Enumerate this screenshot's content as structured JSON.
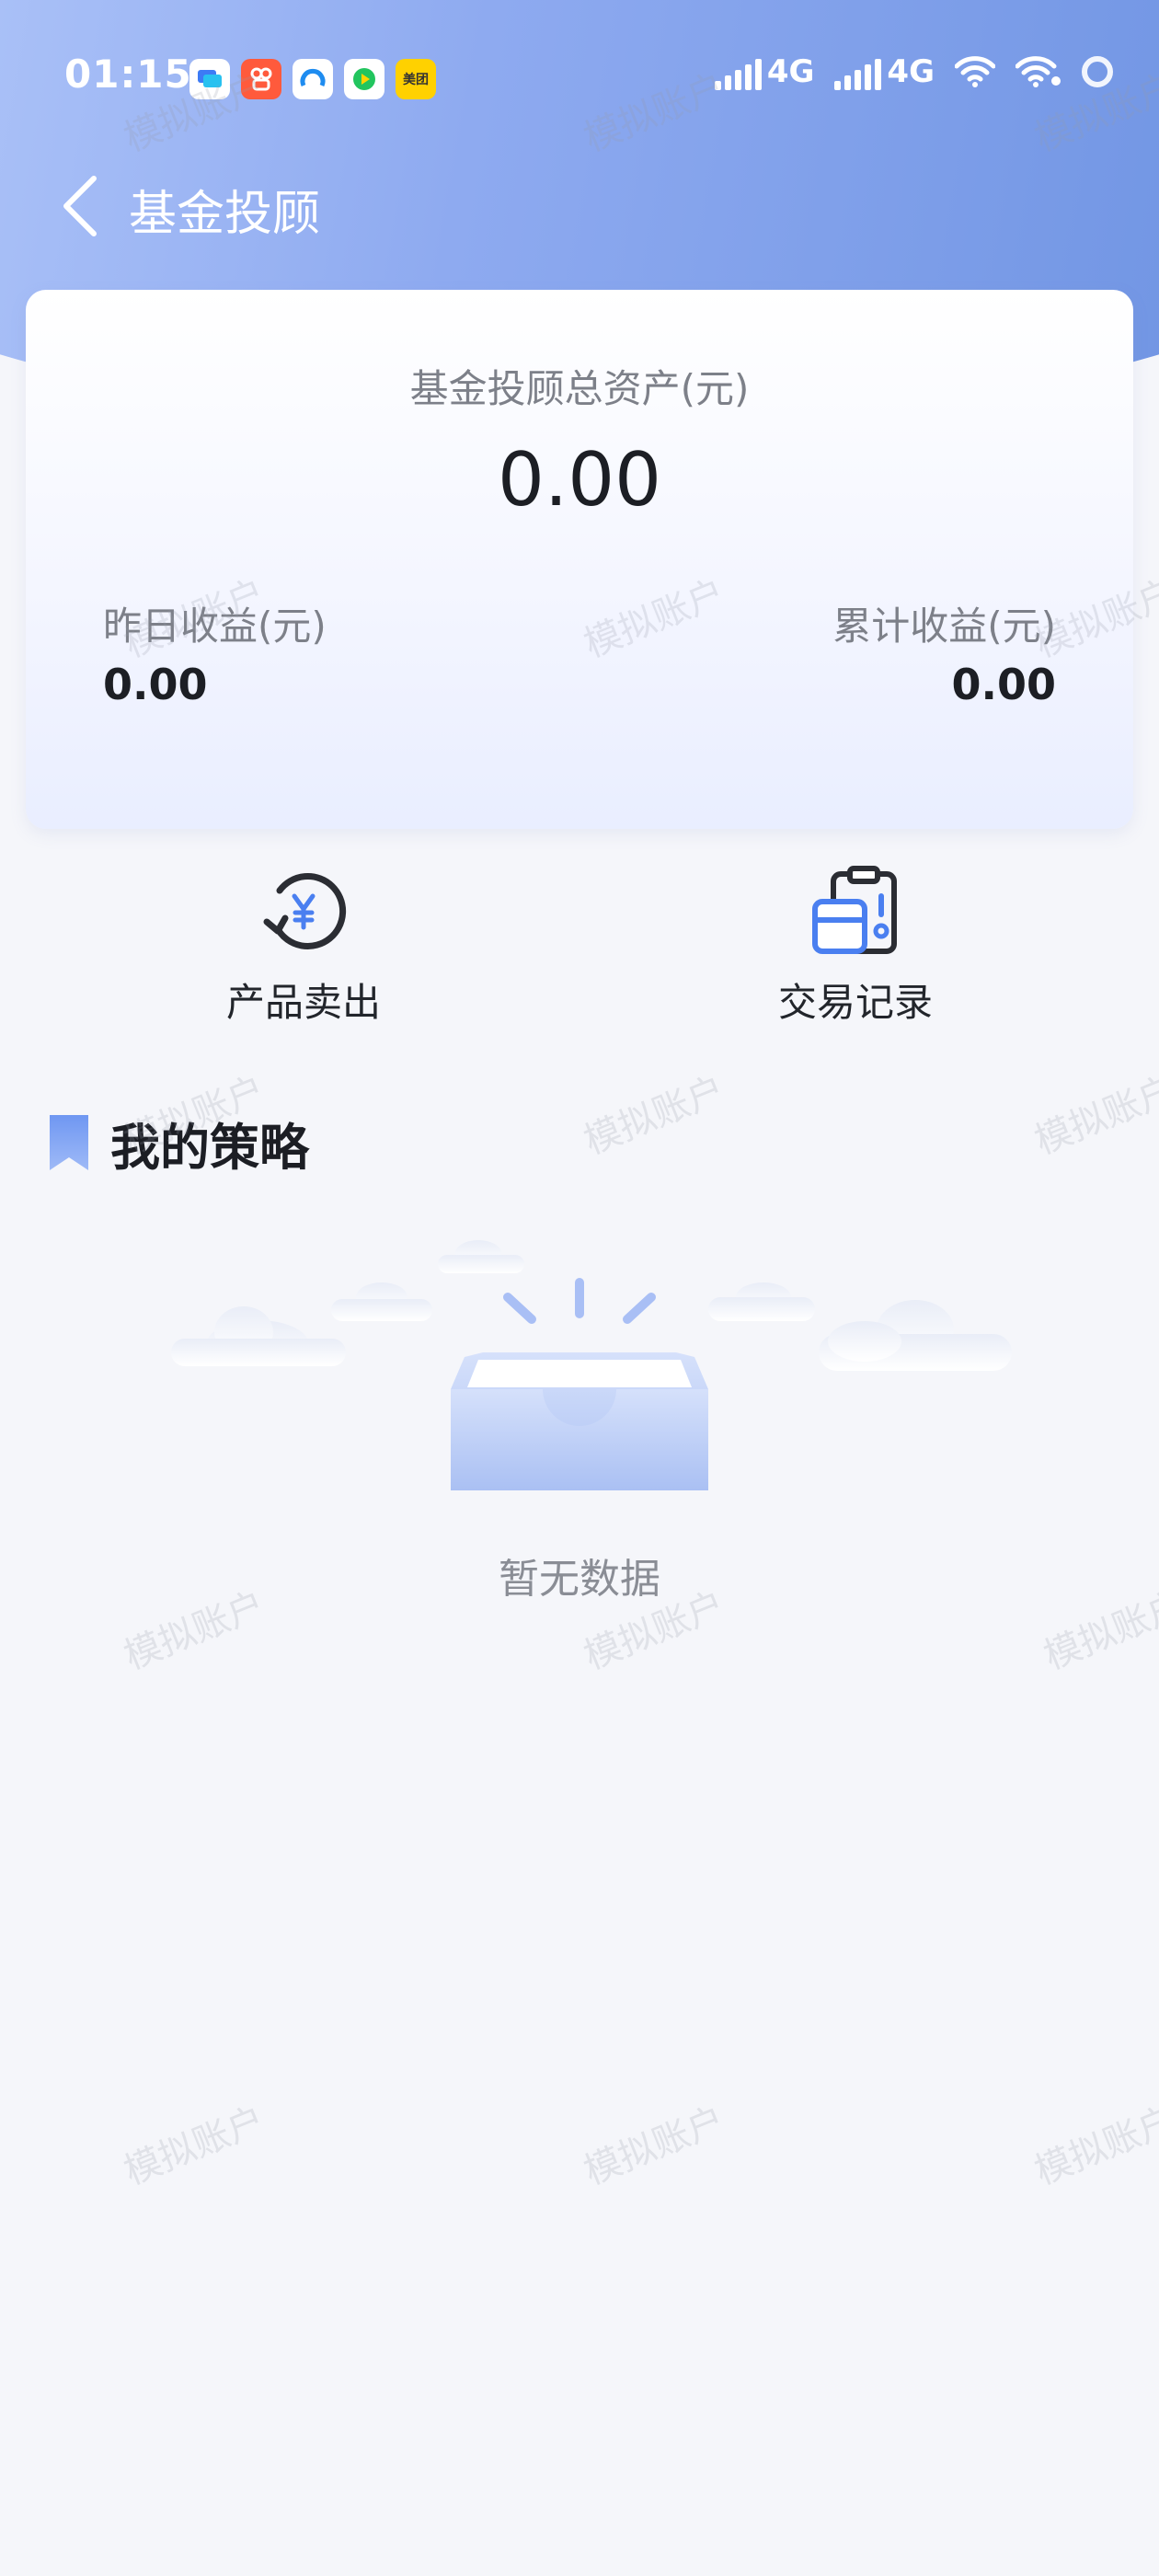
{
  "status_bar": {
    "time": "01:15",
    "app_icons": [
      {
        "name": "message-app-icon",
        "color": "#e8f0ff",
        "text": ""
      },
      {
        "name": "kuaishou-app-icon",
        "color": "#ff5a3c",
        "text": ""
      },
      {
        "name": "browser-app-icon",
        "color": "#e8f3ff",
        "text": ""
      },
      {
        "name": "video-app-icon",
        "color": "#e9f7ef",
        "text": ""
      },
      {
        "name": "meituan-app-icon",
        "color": "#ffd100",
        "text": "美团"
      }
    ],
    "network_1": "4G",
    "network_2": "4G"
  },
  "nav": {
    "title": "基金投顾"
  },
  "asset_card": {
    "total_label": "基金投顾总资产(元)",
    "total_value": "0.00",
    "yesterday_label": "昨日收益(元)",
    "yesterday_value": "0.00",
    "cumulative_label": "累计收益(元)",
    "cumulative_value": "0.00"
  },
  "actions": {
    "sell_label": "产品卖出",
    "records_label": "交易记录"
  },
  "strategy": {
    "title": "我的策略",
    "empty_text": "暂无数据"
  },
  "watermark": "模拟账户",
  "colors": {
    "accent": "#4a7ff0",
    "header": "#7296e4"
  }
}
